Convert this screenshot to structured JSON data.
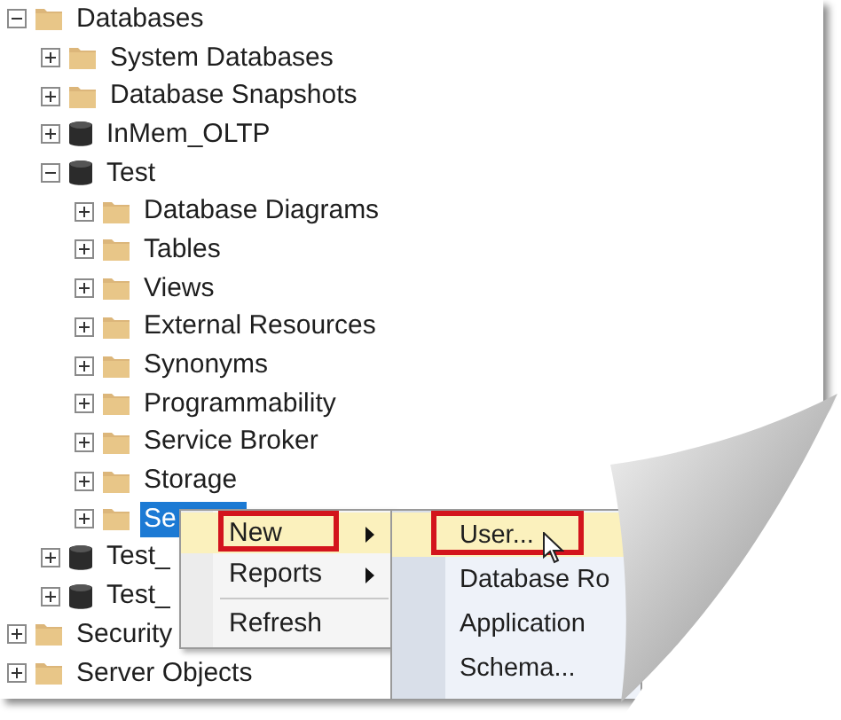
{
  "tree": [
    {
      "label": "Databases",
      "kind": "folder",
      "expanded": true,
      "selected": false,
      "children": [
        {
          "label": "System Databases",
          "kind": "folder",
          "expanded": false,
          "selected": false
        },
        {
          "label": "Database Snapshots",
          "kind": "folder",
          "expanded": false,
          "selected": false
        },
        {
          "label": "InMem_OLTP",
          "kind": "database",
          "expanded": false,
          "selected": false
        },
        {
          "label": "Test",
          "kind": "database",
          "expanded": true,
          "selected": false,
          "children": [
            {
              "label": "Database Diagrams",
              "kind": "folder",
              "expanded": false,
              "selected": false
            },
            {
              "label": "Tables",
              "kind": "folder",
              "expanded": false,
              "selected": false
            },
            {
              "label": "Views",
              "kind": "folder",
              "expanded": false,
              "selected": false
            },
            {
              "label": "External Resources",
              "kind": "folder",
              "expanded": false,
              "selected": false
            },
            {
              "label": "Synonyms",
              "kind": "folder",
              "expanded": false,
              "selected": false
            },
            {
              "label": "Programmability",
              "kind": "folder",
              "expanded": false,
              "selected": false
            },
            {
              "label": "Service Broker",
              "kind": "folder",
              "expanded": false,
              "selected": false
            },
            {
              "label": "Storage",
              "kind": "folder",
              "expanded": false,
              "selected": false
            },
            {
              "label": "Se",
              "kind": "folder",
              "expanded": false,
              "selected": true
            }
          ]
        },
        {
          "label": "Test_",
          "kind": "database",
          "expanded": false,
          "selected": false
        },
        {
          "label": "Test_",
          "kind": "database",
          "expanded": false,
          "selected": false
        }
      ]
    },
    {
      "label": "Security",
      "kind": "folder",
      "expanded": false,
      "selected": false
    },
    {
      "label": "Server Objects",
      "kind": "folder",
      "expanded": false,
      "selected": false
    }
  ],
  "context_menu": {
    "items": [
      {
        "label": "New",
        "submenu": true,
        "selected": true,
        "outlined": true
      },
      {
        "label": "Reports",
        "submenu": true,
        "selected": false,
        "outlined": false
      },
      {
        "label": "Refresh",
        "submenu": false,
        "selected": false,
        "outlined": false
      }
    ]
  },
  "submenu": {
    "items": [
      {
        "label": "User...",
        "selected": true,
        "outlined": true
      },
      {
        "label": "Database Ro",
        "selected": false,
        "outlined": false
      },
      {
        "label": "Application",
        "selected": false,
        "outlined": false
      },
      {
        "label": "Schema...",
        "selected": false,
        "outlined": false
      }
    ]
  }
}
